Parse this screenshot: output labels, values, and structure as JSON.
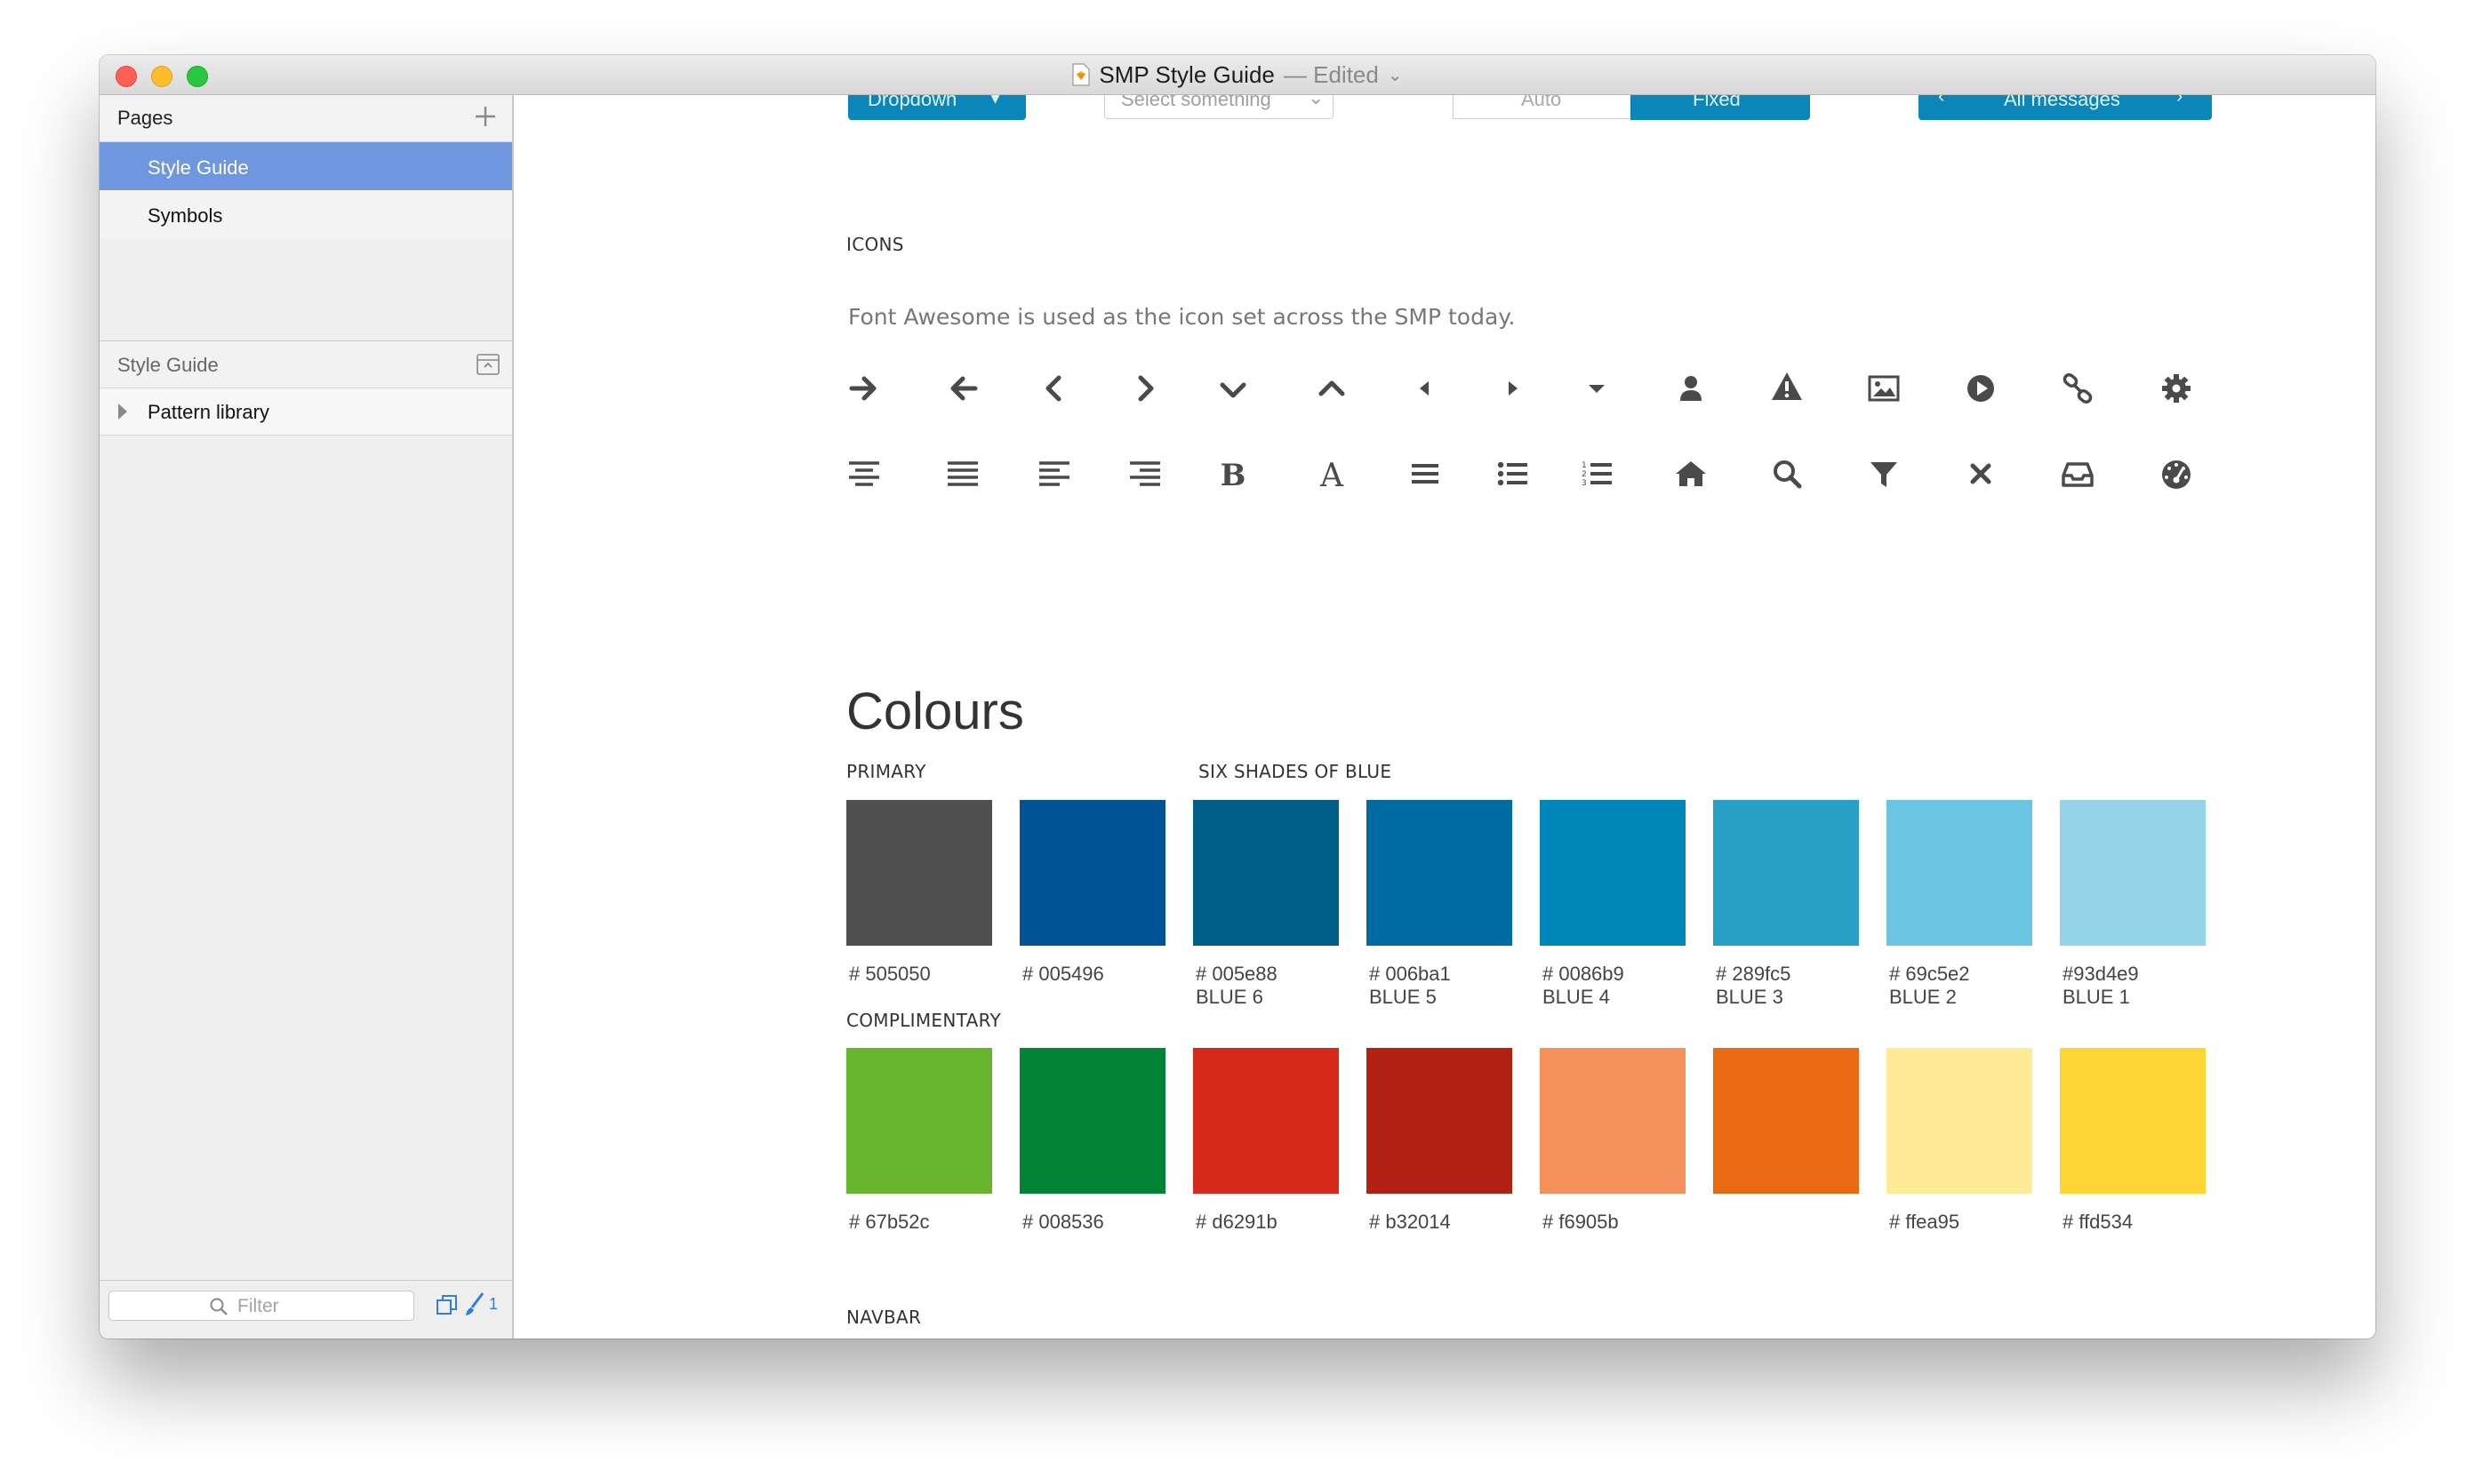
{
  "window": {
    "title": "SMP Style Guide",
    "status": "— Edited",
    "traffic_lights": {
      "close": "#fe5f57",
      "minimize": "#fdbc2e",
      "zoom": "#28c840"
    }
  },
  "sidebar": {
    "pages_title": "Pages",
    "pages": [
      {
        "label": "Style Guide",
        "selected": true
      },
      {
        "label": "Symbols",
        "selected": false
      }
    ],
    "layers_title": "Style Guide",
    "layers": [
      {
        "label": "Pattern library"
      }
    ],
    "filter_placeholder": "Filter",
    "selection_count": "1"
  },
  "canvas": {
    "top_controls": [
      {
        "label": "Dropdown",
        "kind": "dropdown"
      },
      {
        "label": "Select something",
        "kind": "select"
      },
      {
        "label": "Auto",
        "kind": "segment"
      },
      {
        "label": "Fixed",
        "kind": "segment-active"
      },
      {
        "label": "All messages",
        "kind": "pager"
      }
    ],
    "icons_section": {
      "label": "ICONS",
      "description": "Font Awesome is used as the icon set across the SMP today.",
      "row1": [
        "arrow-right-icon",
        "arrow-left-icon",
        "chevron-left-icon",
        "chevron-right-icon",
        "chevron-down-icon",
        "chevron-up-icon",
        "caret-left-icon",
        "caret-right-icon",
        "caret-down-icon",
        "user-icon",
        "warning-icon",
        "image-icon",
        "play-circle-icon",
        "link-icon",
        "gear-icon"
      ],
      "row2": [
        "align-center-icon",
        "align-justify-icon",
        "align-left-icon",
        "align-right-icon",
        "bold-icon",
        "font-icon",
        "bars-icon",
        "list-ul-icon",
        "list-ol-icon",
        "home-icon",
        "search-icon",
        "filter-icon",
        "close-icon",
        "inbox-icon",
        "dashboard-icon"
      ]
    },
    "colours": {
      "heading": "Colours",
      "primary_label": "PRIMARY",
      "blue_label": "SIX SHADES OF BLUE",
      "complimentary_label": "COMPLIMENTARY",
      "row1": [
        {
          "color": "#505050",
          "hex": "# 505050",
          "name": ""
        },
        {
          "color": "#005496",
          "hex": "# 005496",
          "name": ""
        },
        {
          "color": "#005e88",
          "hex": "# 005e88",
          "name": "BLUE 6"
        },
        {
          "color": "#006ba1",
          "hex": "# 006ba1",
          "name": "BLUE 5"
        },
        {
          "color": "#0086b9",
          "hex": "# 0086b9",
          "name": "BLUE 4"
        },
        {
          "color": "#289fc5",
          "hex": "# 289fc5",
          "name": "BLUE 3"
        },
        {
          "color": "#69c5e2",
          "hex": "# 69c5e2",
          "name": "BLUE 2"
        },
        {
          "color": "#93d4e9",
          "hex": "#93d4e9",
          "name": "BLUE 1"
        }
      ],
      "row2": [
        {
          "color": "#67b52c",
          "hex": "# 67b52c"
        },
        {
          "color": "#008536",
          "hex": "# 008536"
        },
        {
          "color": "#d6291b",
          "hex": "# d6291b"
        },
        {
          "color": "#b32014",
          "hex": "# b32014"
        },
        {
          "color": "#f6905b",
          "hex": "# f6905b"
        },
        {
          "color": "#ea6a13",
          "hex": ""
        },
        {
          "color": "#ffea95",
          "hex": "# ffea95"
        },
        {
          "color": "#ffd534",
          "hex": "# ffd534"
        }
      ]
    },
    "navbar_label": "NAVBAR"
  }
}
